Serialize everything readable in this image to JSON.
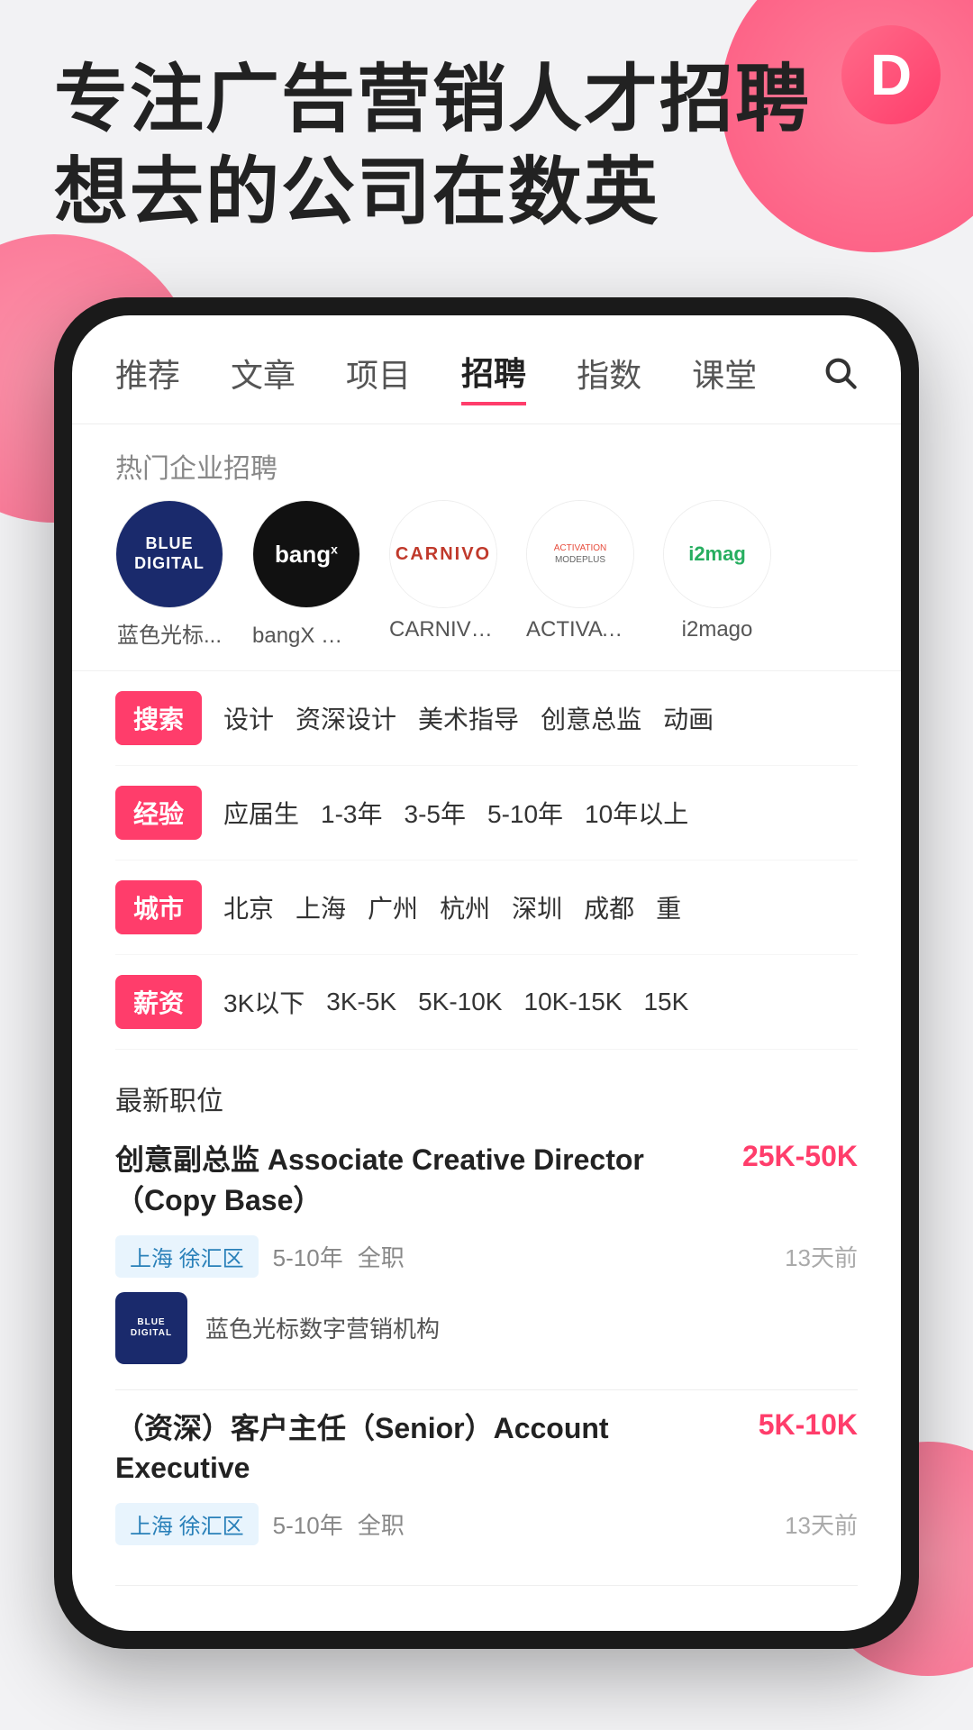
{
  "app": {
    "logo_letter": "D",
    "hero_line1": "专注广告营销人才招聘",
    "hero_line2": "想去的公司在数英"
  },
  "nav": {
    "items": [
      {
        "label": "推荐",
        "active": false
      },
      {
        "label": "文章",
        "active": false
      },
      {
        "label": "项目",
        "active": false
      },
      {
        "label": "招聘",
        "active": true
      },
      {
        "label": "指数",
        "active": false
      },
      {
        "label": "课堂",
        "active": false
      }
    ],
    "search_icon": "search"
  },
  "hot_companies": {
    "section_label": "热门企业招聘",
    "companies": [
      {
        "name": "蓝色光标...",
        "logo_type": "blue-digital"
      },
      {
        "name": "bangX 上海",
        "logo_type": "bangx"
      },
      {
        "name": "CARNIVO...",
        "logo_type": "carnivo"
      },
      {
        "name": "ACTIVATIO...",
        "logo_type": "activation"
      },
      {
        "name": "i2mago",
        "logo_type": "i2mago"
      }
    ]
  },
  "filters": [
    {
      "tag": "搜索",
      "options": [
        "设计",
        "资深设计",
        "美术指导",
        "创意总监",
        "动画"
      ]
    },
    {
      "tag": "经验",
      "options": [
        "应届生",
        "1-3年",
        "3-5年",
        "5-10年",
        "10年以上"
      ]
    },
    {
      "tag": "城市",
      "options": [
        "北京",
        "上海",
        "广州",
        "杭州",
        "深圳",
        "成都",
        "重"
      ]
    },
    {
      "tag": "薪资",
      "options": [
        "3K以下",
        "3K-5K",
        "5K-10K",
        "10K-15K",
        "15K"
      ]
    }
  ],
  "jobs": {
    "section_title": "最新职位",
    "list": [
      {
        "title": "创意副总监 Associate Creative Director（Copy Base）",
        "salary": "25K-50K",
        "location": "上海 徐汇区",
        "experience": "5-10年",
        "type": "全职",
        "time": "13天前",
        "company_name": "蓝色光标数字营销机构",
        "company_logo": "blue-digital"
      },
      {
        "title": "（资深）客户主任（Senior）Account Executive",
        "salary": "5K-10K",
        "location": "上海 徐汇区",
        "experience": "5-10年",
        "type": "全职",
        "time": "13天前",
        "company_name": "",
        "company_logo": ""
      }
    ]
  }
}
